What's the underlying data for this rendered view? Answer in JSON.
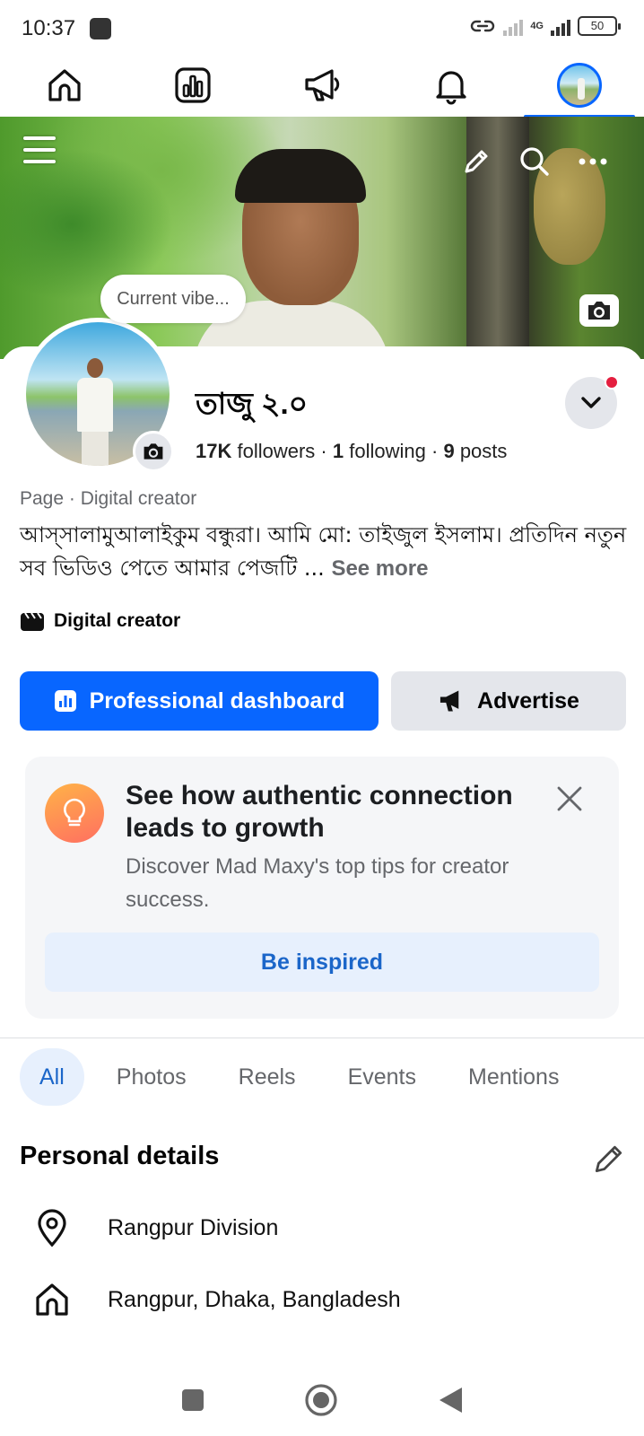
{
  "status_bar": {
    "time": "10:37",
    "network": "4G",
    "battery": "50"
  },
  "top_nav": {
    "items": [
      {
        "icon": "home-icon"
      },
      {
        "icon": "dashboard-icon"
      },
      {
        "icon": "megaphone-icon"
      },
      {
        "icon": "bell-icon"
      },
      {
        "icon": "profile-avatar",
        "active": true
      }
    ]
  },
  "cover": {
    "vibe_prompt": "Current vibe..."
  },
  "profile": {
    "name": "তাজু ২.০",
    "followers_count": "17K",
    "followers_label": "followers",
    "following_count": "1",
    "following_label": "following",
    "posts_count": "9",
    "posts_label": "posts",
    "separator": "·",
    "page_category": "Page · Digital creator",
    "bio": "আস্সালামুআলাইকুম বন্ধুরা। আমি মো: তাইজুল ইসলাম। প্রতিদিন নতুন সব ভিডিও পেতে আমার পেজটি ...",
    "see_more": "See more",
    "creator_tag": "Digital creator"
  },
  "actions": {
    "dashboard_label": "Professional dashboard",
    "advertise_label": "Advertise"
  },
  "tip_card": {
    "title": "See how authentic connection leads to growth",
    "description": "Discover Mad Maxy's top tips for creator success.",
    "cta": "Be inspired"
  },
  "filter_tabs": [
    "All",
    "Photos",
    "Reels",
    "Events",
    "Mentions"
  ],
  "personal_details": {
    "title": "Personal details",
    "items": [
      {
        "icon": "location-pin-icon",
        "text": "Rangpur Division"
      },
      {
        "icon": "home-icon",
        "text": "Rangpur, Dhaka, Bangladesh"
      }
    ]
  },
  "colors": {
    "accent": "#0866ff",
    "accent_light": "#e7f0fd",
    "secondary_button": "#e4e6eb",
    "muted_text": "#65676b",
    "notification_dot": "#e41e3f"
  }
}
